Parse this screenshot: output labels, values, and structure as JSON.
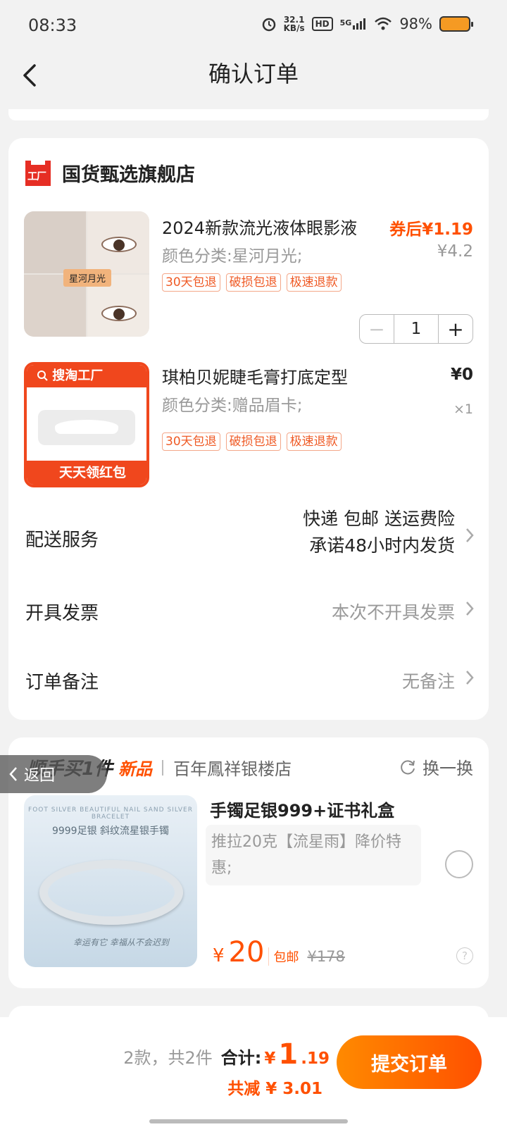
{
  "status_bar": {
    "time": "08:33",
    "net_speed_value": "32.1",
    "net_speed_unit": "KB/s",
    "hd": "HD",
    "network": "5G",
    "battery": "98%"
  },
  "nav": {
    "title": "确认订单"
  },
  "shop": {
    "logo_text": "工厂",
    "name": "国货甄选旗舰店"
  },
  "items": [
    {
      "title": "2024新款流光液体眼影液",
      "variant": "颜色分类:星河月光;",
      "image_tag": "星河月光",
      "tags": [
        "30天包退",
        "破损包退",
        "极速退款"
      ],
      "coupon_price": "券后¥1.19",
      "original_price": "¥4.2",
      "quantity": "1",
      "minus": "−",
      "plus": "+"
    },
    {
      "title": "琪柏贝妮睫毛膏打底定型",
      "variant": "颜色分类:赠品眉卡;",
      "image_top": "搜淘工厂",
      "image_bottom": "天天领红包",
      "tags": [
        "30天包退",
        "破损包退",
        "极速退款"
      ],
      "price": "¥0",
      "quantity_text": "×1"
    }
  ],
  "delivery": {
    "label": "配送服务",
    "line1": "快递 包邮 送运费险",
    "line2": "承诺48小时内发货"
  },
  "invoice": {
    "label": "开具发票",
    "value": "本次不开具发票"
  },
  "remark": {
    "label": "订单备注",
    "value": "无备注"
  },
  "recommend": {
    "slogan": "顺手买1件",
    "new_tag": "新品",
    "shop": "百年鳳祥银楼店",
    "swap": "换一换",
    "image_caption_en": "FOOT SILVER BEAUTIFUL NAIL SAND SILVER BRACELET",
    "image_caption": "9999足银 斜纹流星银手镯",
    "image_script": "幸运有它 幸福从不会迟到",
    "title": "手镯足银999+证书礼盒",
    "spec": "推拉20克【流星雨】降价特惠;",
    "price_symbol": "¥",
    "price": "20",
    "shipping": "包邮",
    "original_price": "¥178",
    "help": "?"
  },
  "back_overlay": "返回",
  "bottom": {
    "count": "2款，共2件",
    "total_label": "合计:",
    "total_symbol": "¥",
    "total_int": "1",
    "total_dec": ".19",
    "discount": "共减 ¥ 3.01",
    "submit": "提交订单"
  },
  "colors": {
    "accent": "#ff5000",
    "shop_red": "#e62e24",
    "tag_orange": "#ef5a25"
  }
}
